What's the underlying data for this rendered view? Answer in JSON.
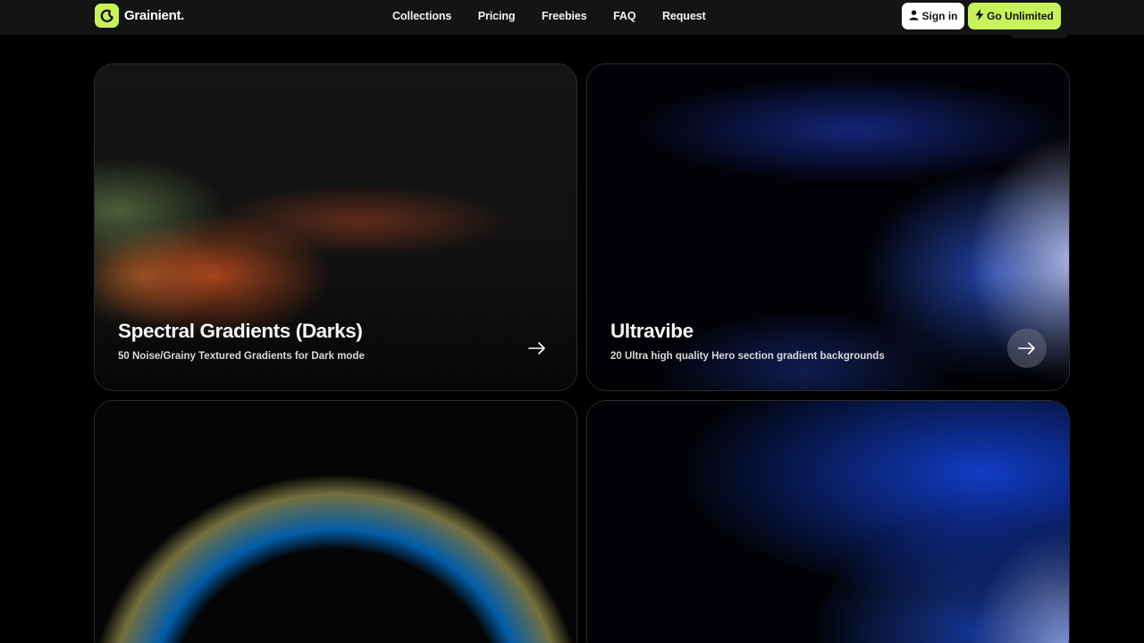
{
  "brand": {
    "name": "Grainient.",
    "accent": "#c8f25a",
    "logo_icon": "moon-icon"
  },
  "nav": {
    "links": [
      "Collections",
      "Pricing",
      "Freebies",
      "FAQ",
      "Request"
    ],
    "signin_label": "Sign in",
    "signin_icon": "user-icon",
    "unlimited_label": "Go Unlimited",
    "unlimited_icon": "lightning-icon"
  },
  "cards": [
    {
      "title": "Spectral Gradients (Darks)",
      "subtitle": "50 Noise/Grainy Textured Gradients for Dark mode",
      "arrow_icon": "arrow-right-icon"
    },
    {
      "title": "Ultravibe",
      "subtitle": "20 Ultra high quality Hero section gradient backgrounds",
      "arrow_icon": "arrow-right-icon"
    },
    {
      "title": "",
      "subtitle": ""
    },
    {
      "title": "",
      "subtitle": ""
    }
  ]
}
